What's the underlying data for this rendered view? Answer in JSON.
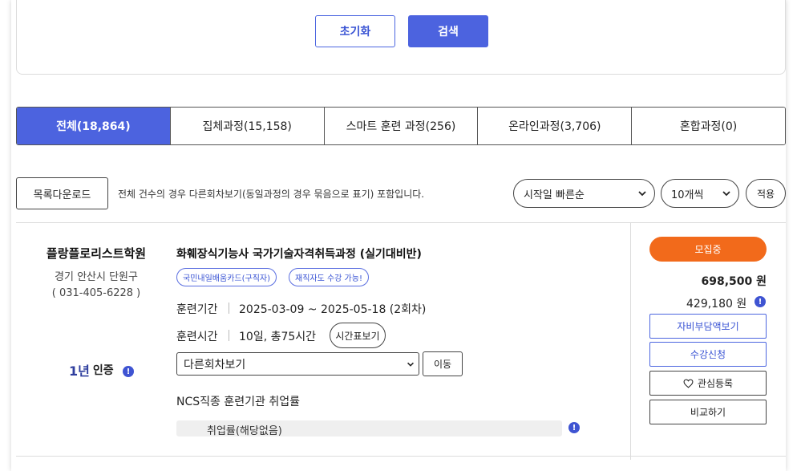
{
  "search": {
    "reset_label": "초기화",
    "search_label": "검색"
  },
  "tabs": [
    {
      "label": "전체(18,864)",
      "active": true
    },
    {
      "label": "집체과정(15,158)",
      "active": false
    },
    {
      "label": "스마트 훈련 과정(256)",
      "active": false
    },
    {
      "label": "온라인과정(3,706)",
      "active": false
    },
    {
      "label": "혼합과정(0)",
      "active": false
    }
  ],
  "toolbar": {
    "download_label": "목록다운로드",
    "notice": "전체 건수의 경우 다른회차보기(동일과정의 경우 묶음으로 표기) 포함입니다.",
    "sort_value": "시작일 빠른순",
    "count_value": "10개씩",
    "apply_label": "적용"
  },
  "course": {
    "institution": "플랑플로리스트학원",
    "address": "경기 안산시 단원구",
    "phone": "( 031-405-6228 )",
    "cert_big": "1년",
    "cert_label": "인증",
    "title": "화훼장식기능사 국가기술자격취득과정 (실기대비반)",
    "badges": [
      "국민내일배움카드(구직자)",
      "재직자도 수강 가능!"
    ],
    "period_label": "훈련기간",
    "period_value": "2025-03-09 ~ 2025-05-18 (2회차)",
    "time_label": "훈련시간",
    "time_value": "10일, 총75시간",
    "schedule_label": "시간표보기",
    "rounds_value": "다른회차보기",
    "move_label": "이동",
    "ncs_label": "NCS직종 훈련기관 취업률",
    "rate_text": "취업률(해당없음)"
  },
  "side": {
    "status": "모집중",
    "price_total": "698,500 원",
    "price_self": "429,180 원",
    "btn_self_pay": "자비부담액보기",
    "btn_apply": "수강신청",
    "btn_favorite": "관심등록",
    "btn_compare": "비교하기"
  },
  "colors": {
    "primary": "#4c63df",
    "status": "#f26a1b"
  }
}
